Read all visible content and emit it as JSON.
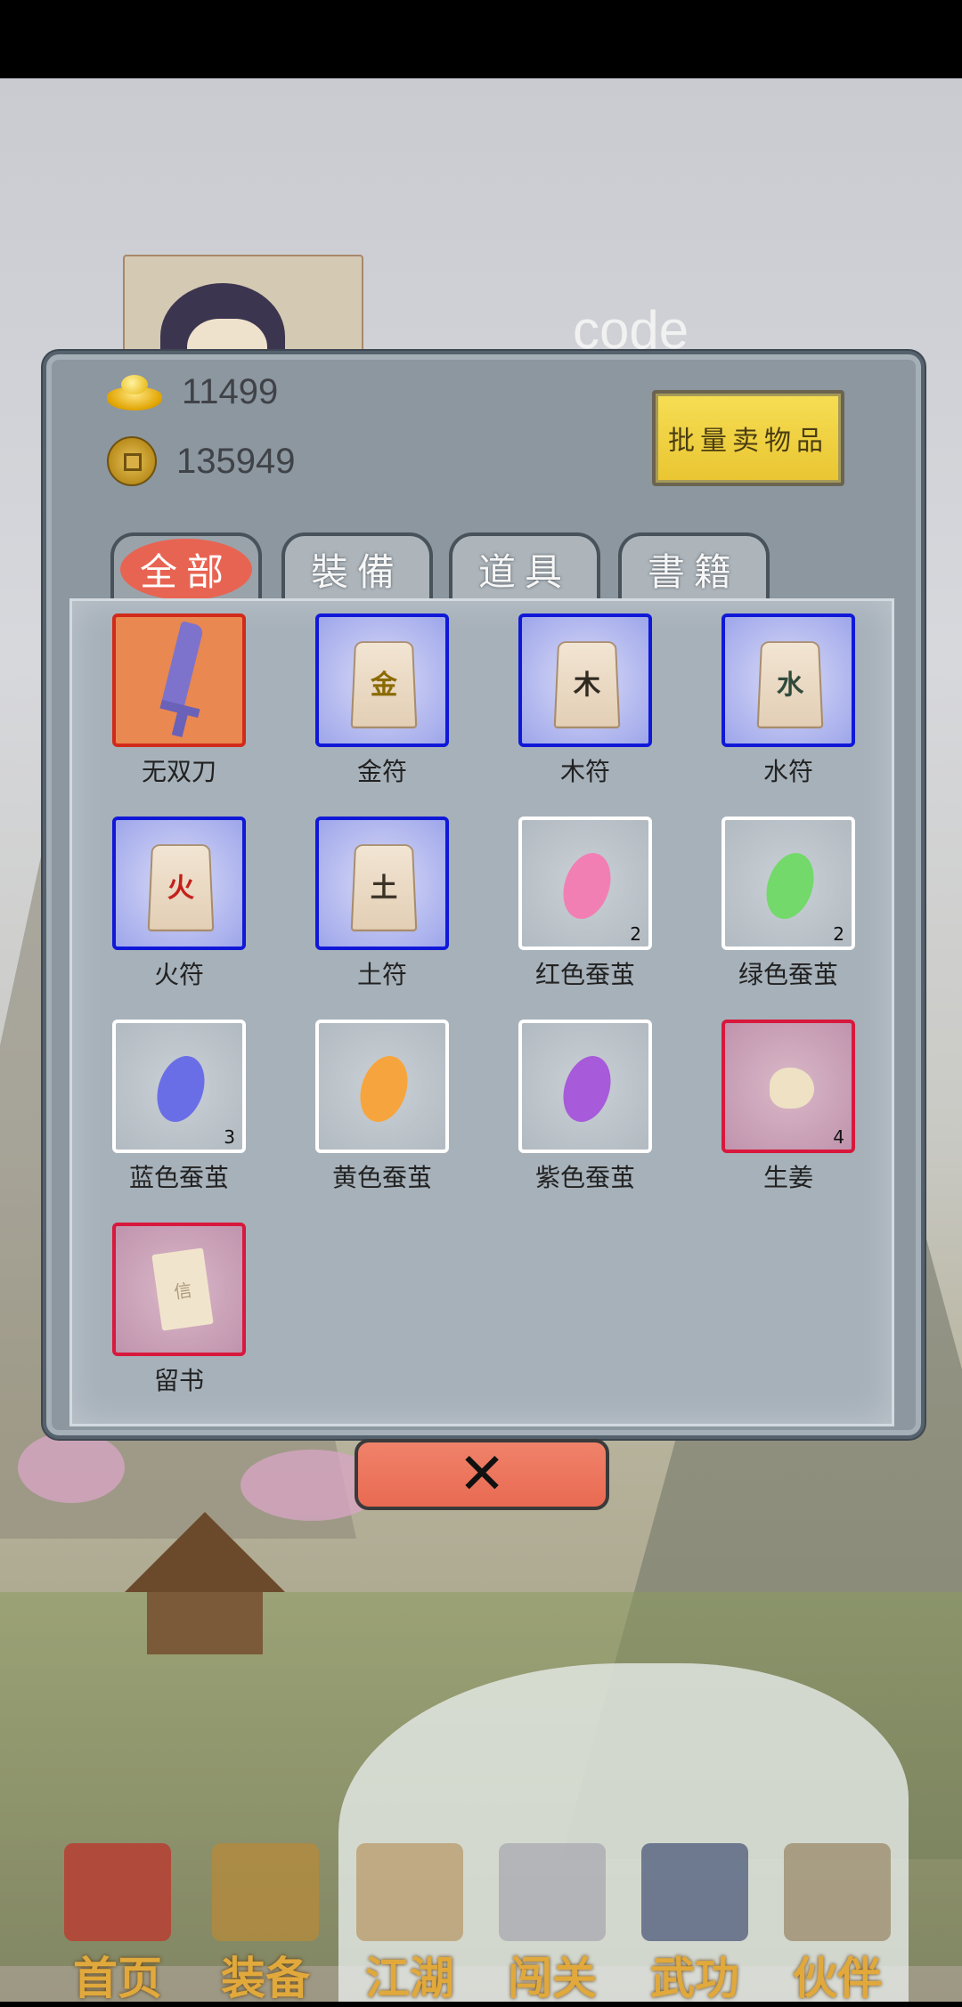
{
  "background": {
    "code_text": "code"
  },
  "currency": {
    "gold": "11499",
    "coins": "135949"
  },
  "sell_button": "批量卖物品",
  "tabs": [
    {
      "label": "全部",
      "active": true
    },
    {
      "label": "裝備",
      "active": false
    },
    {
      "label": "道具",
      "active": false
    },
    {
      "label": "書籍",
      "active": false
    }
  ],
  "items": [
    {
      "name": "无双刀",
      "count": "",
      "rarity": "orange",
      "icon": "sword-icon"
    },
    {
      "name": "金符",
      "count": "",
      "rarity": "blue",
      "icon": "talisman-icon",
      "glyph": "金",
      "glyph_color": "#8a6a00"
    },
    {
      "name": "木符",
      "count": "",
      "rarity": "blue",
      "icon": "talisman-icon",
      "glyph": "木",
      "glyph_color": "#2f2a20"
    },
    {
      "name": "水符",
      "count": "",
      "rarity": "blue",
      "icon": "talisman-icon",
      "glyph": "水",
      "glyph_color": "#2f4a3a"
    },
    {
      "name": "火符",
      "count": "",
      "rarity": "blue",
      "icon": "talisman-icon",
      "glyph": "火",
      "glyph_color": "#c2201a"
    },
    {
      "name": "土符",
      "count": "",
      "rarity": "blue",
      "icon": "talisman-icon",
      "glyph": "土",
      "glyph_color": "#3a3226"
    },
    {
      "name": "红色蚕茧",
      "count": "2",
      "rarity": "white",
      "icon": "cocoon-icon",
      "color": "#f27fb4"
    },
    {
      "name": "绿色蚕茧",
      "count": "2",
      "rarity": "white",
      "icon": "cocoon-icon",
      "color": "#72d96a"
    },
    {
      "name": "蓝色蚕茧",
      "count": "3",
      "rarity": "white",
      "icon": "cocoon-icon",
      "color": "#6a6ee6"
    },
    {
      "name": "黄色蚕茧",
      "count": "",
      "rarity": "white",
      "icon": "cocoon-icon",
      "color": "#f6a53e"
    },
    {
      "name": "紫色蚕茧",
      "count": "",
      "rarity": "white",
      "icon": "cocoon-icon",
      "color": "#a75ad9"
    },
    {
      "name": "生姜",
      "count": "4",
      "rarity": "red",
      "icon": "ginger-icon"
    },
    {
      "name": "留书",
      "count": "",
      "rarity": "red",
      "icon": "letter-icon",
      "glyph": "信"
    }
  ],
  "close_button": "✕",
  "nav": [
    {
      "label": "首页",
      "icon": "house-icon",
      "active": true,
      "color": "#b04a3a"
    },
    {
      "label": "装备",
      "icon": "armor-icon",
      "active": false,
      "color": "#b58a3a"
    },
    {
      "label": "江湖",
      "icon": "scroll-map-icon",
      "active": false,
      "color": "#b89a6a"
    },
    {
      "label": "闯关",
      "icon": "crossed-swords-icon",
      "active": false,
      "color": "#a8a8b0"
    },
    {
      "label": "武功",
      "icon": "book-icon",
      "active": false,
      "color": "#4c5a7a"
    },
    {
      "label": "伙伴",
      "icon": "partners-icon",
      "active": false,
      "color": "#9a8a6a"
    }
  ]
}
